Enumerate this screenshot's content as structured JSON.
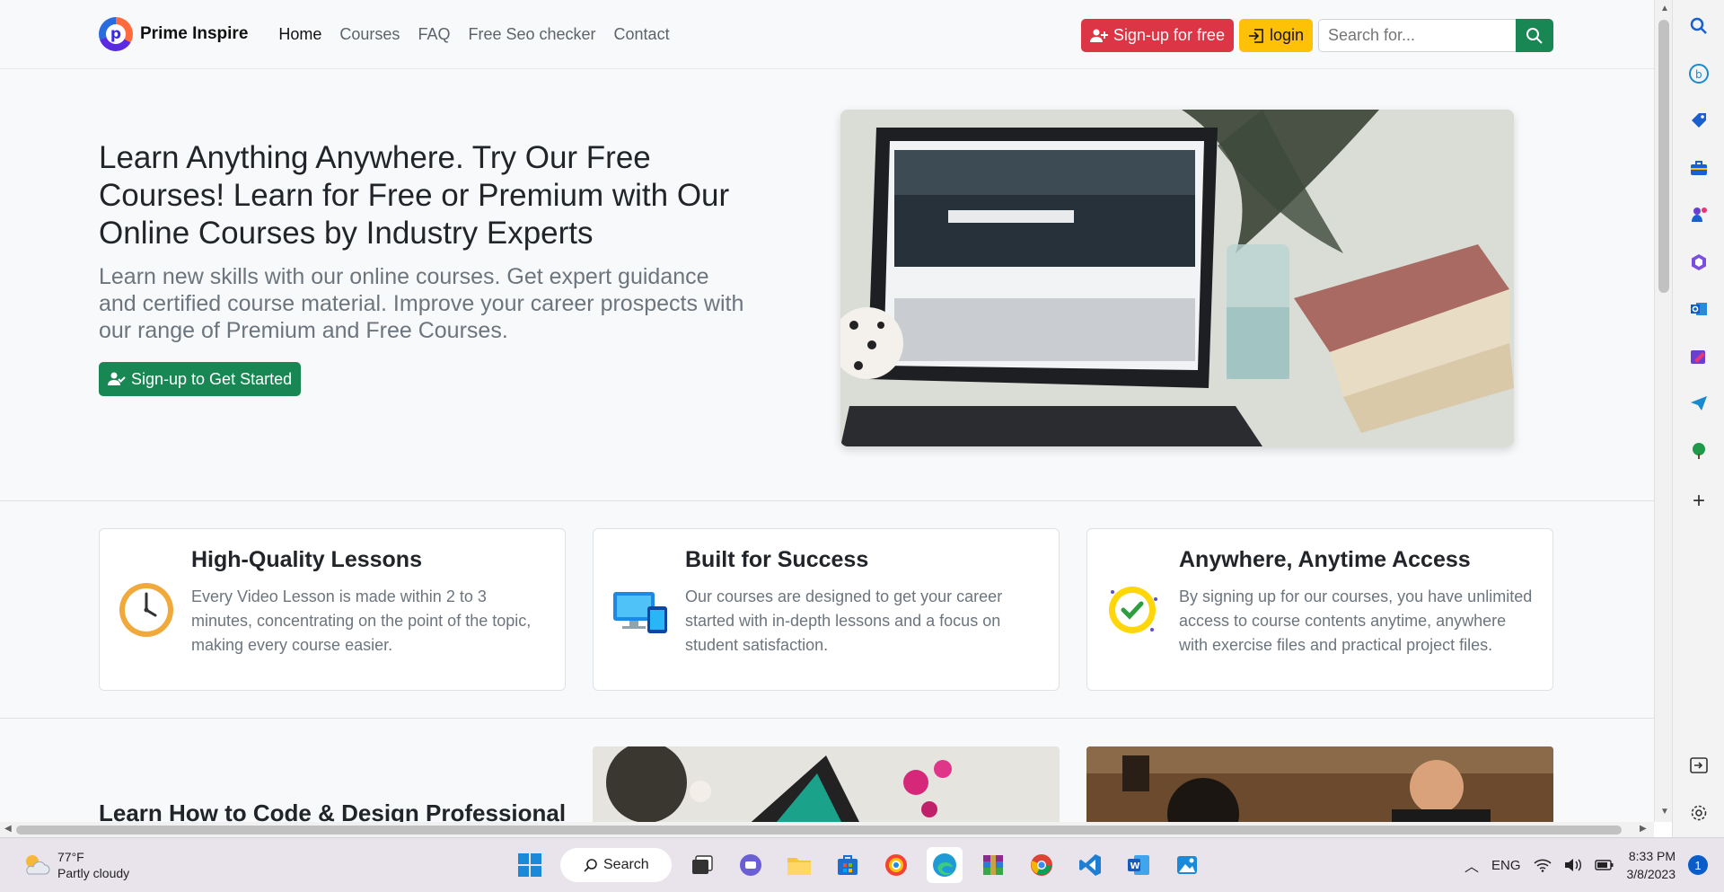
{
  "navbar": {
    "brand": "Prime Inspire",
    "links": [
      "Home",
      "Courses",
      "FAQ",
      "Free Seo checker",
      "Contact"
    ],
    "signup_label": "Sign-up for free",
    "login_label": "login",
    "search_placeholder": "Search for..."
  },
  "hero": {
    "title": "Learn Anything Anywhere. Try Our Free Courses! Learn for Free or Premium with Our Online Courses by Industry Experts",
    "lead": "Learn new skills with our online courses. Get expert guidance and certified course material. Improve your career prospects with our range of Premium and Free Courses.",
    "cta_label": "Sign-up to Get Started"
  },
  "features": [
    {
      "title": "High-Quality Lessons",
      "text": "Every Video Lesson is made within 2 to 3 minutes, concentrating on the point of the topic, making every course easier.",
      "icon": "clock-icon"
    },
    {
      "title": "Built for Success",
      "text": "Our courses are designed to get your career started with in-depth lessons and a focus on student satisfaction.",
      "icon": "devices-icon"
    },
    {
      "title": "Anywhere, Anytime Access",
      "text": "By signing up for our courses, you have unlimited access to course contents anytime, anywhere with exercise files and practical project files.",
      "icon": "check-badge-icon"
    }
  ],
  "section2": {
    "title": "Learn How to Code & Design Professional"
  },
  "taskbar": {
    "temp": "77°F",
    "weather": "Partly cloudy",
    "search_label": "Search",
    "lang": "ENG",
    "time": "8:33 PM",
    "date": "3/8/2023",
    "notifications": "1"
  },
  "colors": {
    "brand_green": "#198754",
    "brand_red": "#dc3545",
    "brand_yellow": "#ffc107"
  }
}
